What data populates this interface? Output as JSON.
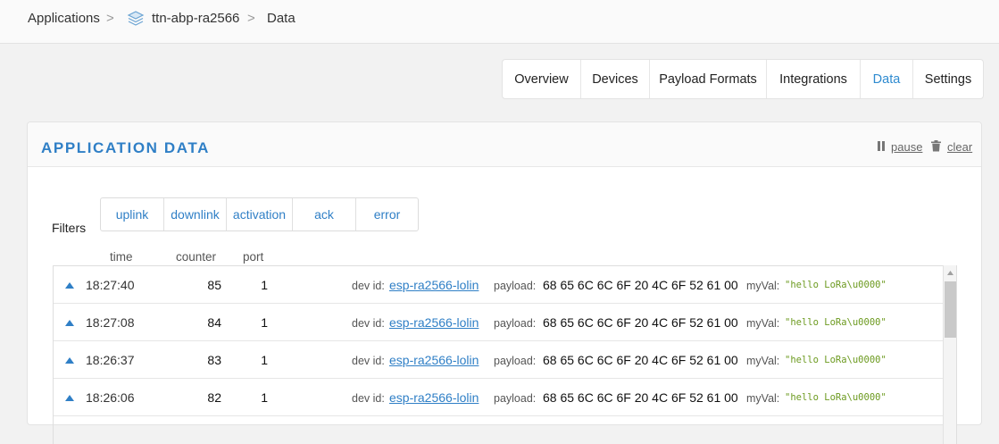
{
  "breadcrumb": {
    "applications": "Applications",
    "separator": ">",
    "app_id": "ttn-abp-ra2566",
    "current": "Data",
    "app_icon": "layers-icon"
  },
  "tabs": [
    {
      "label": "Overview",
      "active": false
    },
    {
      "label": "Devices",
      "active": false
    },
    {
      "label": "Payload Formats",
      "active": false
    },
    {
      "label": "Integrations",
      "active": false
    },
    {
      "label": "Data",
      "active": true
    },
    {
      "label": "Settings",
      "active": false
    }
  ],
  "panel": {
    "title": "APPLICATION DATA",
    "pause_label": "pause",
    "clear_label": "clear",
    "pause_icon": "pause-icon",
    "clear_icon": "trash-icon"
  },
  "filters": {
    "label": "Filters",
    "options": [
      "uplink",
      "downlink",
      "activation",
      "ack",
      "error"
    ]
  },
  "columns": {
    "time": "time",
    "counter": "counter",
    "port": "port"
  },
  "row_labels": {
    "dev_id": "dev id:",
    "payload": "payload:",
    "my_val": "myVal:"
  },
  "rows": [
    {
      "time": "18:27:40",
      "counter": "85",
      "port": "1",
      "dev_id": "esp-ra2566-lolin",
      "payload": "68 65 6C 6C 6F 20 4C 6F 52 61 00",
      "my_val": "\"hello LoRa\\u0000\""
    },
    {
      "time": "18:27:08",
      "counter": "84",
      "port": "1",
      "dev_id": "esp-ra2566-lolin",
      "payload": "68 65 6C 6C 6F 20 4C 6F 52 61 00",
      "my_val": "\"hello LoRa\\u0000\""
    },
    {
      "time": "18:26:37",
      "counter": "83",
      "port": "1",
      "dev_id": "esp-ra2566-lolin",
      "payload": "68 65 6C 6C 6F 20 4C 6F 52 61 00",
      "my_val": "\"hello LoRa\\u0000\""
    },
    {
      "time": "18:26:06",
      "counter": "82",
      "port": "1",
      "dev_id": "esp-ra2566-lolin",
      "payload": "68 65 6C 6C 6F 20 4C 6F 52 61 00",
      "my_val": "\"hello LoRa\\u0000\""
    }
  ],
  "colors": {
    "accent": "#2f7fc6",
    "value_green": "#6c9a1f"
  }
}
